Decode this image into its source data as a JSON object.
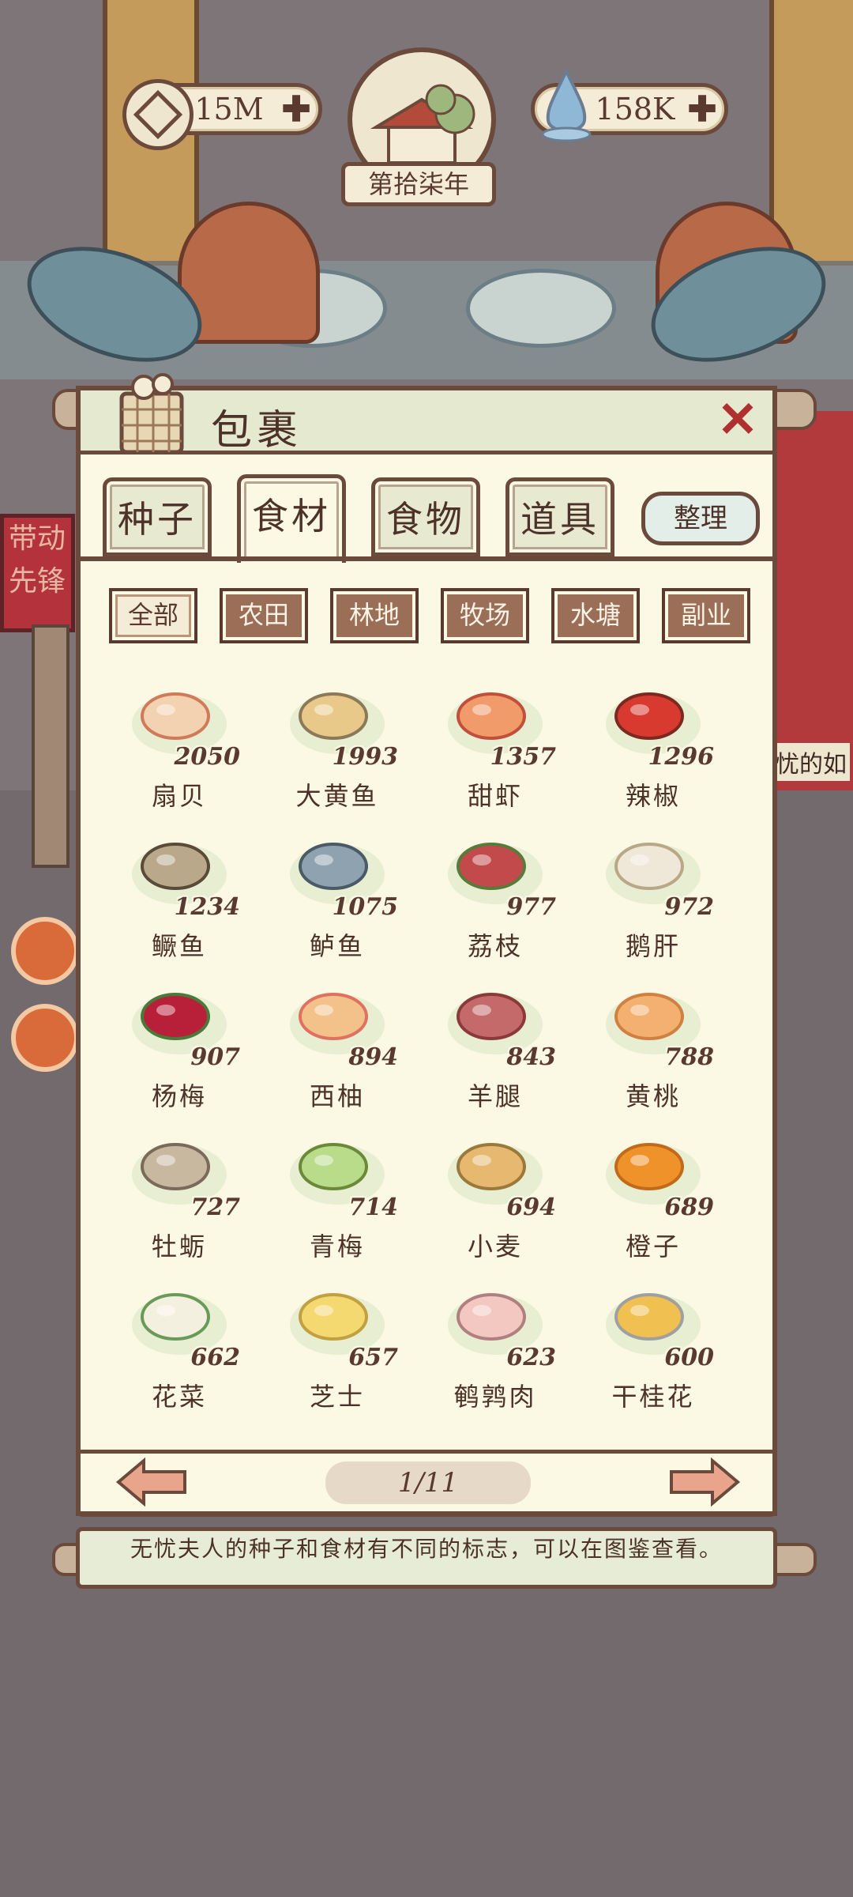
{
  "resources": {
    "coins": "15M",
    "water": "158K",
    "year": "第拾柒年"
  },
  "background": {
    "banner_text": "带动先锋",
    "side_text": "忧的如"
  },
  "panel": {
    "title": "包裹",
    "close": "✕"
  },
  "tabs": [
    "种子",
    "食材",
    "食物",
    "道具"
  ],
  "active_tab": "食材",
  "tidy_label": "整理",
  "filters": [
    "全部",
    "农田",
    "林地",
    "牧场",
    "水塘",
    "副业"
  ],
  "active_filter": "全部",
  "items": [
    {
      "name": "扇贝",
      "count": "2050",
      "icon": "scallop-icon"
    },
    {
      "name": "大黄鱼",
      "count": "1993",
      "icon": "yellow-croaker-icon"
    },
    {
      "name": "甜虾",
      "count": "1357",
      "icon": "shrimp-icon"
    },
    {
      "name": "辣椒",
      "count": "1296",
      "icon": "chili-icon"
    },
    {
      "name": "鳜鱼",
      "count": "1234",
      "icon": "mandarin-fish-icon"
    },
    {
      "name": "鲈鱼",
      "count": "1075",
      "icon": "perch-icon"
    },
    {
      "name": "荔枝",
      "count": "977",
      "icon": "lychee-icon"
    },
    {
      "name": "鹅肝",
      "count": "972",
      "icon": "foie-gras-icon"
    },
    {
      "name": "杨梅",
      "count": "907",
      "icon": "bayberry-icon"
    },
    {
      "name": "西柚",
      "count": "894",
      "icon": "grapefruit-icon"
    },
    {
      "name": "羊腿",
      "count": "843",
      "icon": "lamb-leg-icon"
    },
    {
      "name": "黄桃",
      "count": "788",
      "icon": "yellow-peach-icon"
    },
    {
      "name": "牡蛎",
      "count": "727",
      "icon": "oyster-icon"
    },
    {
      "name": "青梅",
      "count": "714",
      "icon": "green-plum-icon"
    },
    {
      "name": "小麦",
      "count": "694",
      "icon": "wheat-icon"
    },
    {
      "name": "橙子",
      "count": "689",
      "icon": "orange-icon"
    },
    {
      "name": "花菜",
      "count": "662",
      "icon": "cauliflower-icon"
    },
    {
      "name": "芝士",
      "count": "657",
      "icon": "cheese-icon"
    },
    {
      "name": "鹌鹑肉",
      "count": "623",
      "icon": "quail-meat-icon"
    },
    {
      "name": "干桂花",
      "count": "600",
      "icon": "dried-osmanthus-icon"
    }
  ],
  "pagination": {
    "label": "1/11"
  },
  "tip": "无忧夫人的种子和食材有不同的标志，可以在图鉴查看。",
  "colors": {
    "frame": "#6b4a3c",
    "panel": "#fbf8e4",
    "accent_red": "#b03030"
  }
}
